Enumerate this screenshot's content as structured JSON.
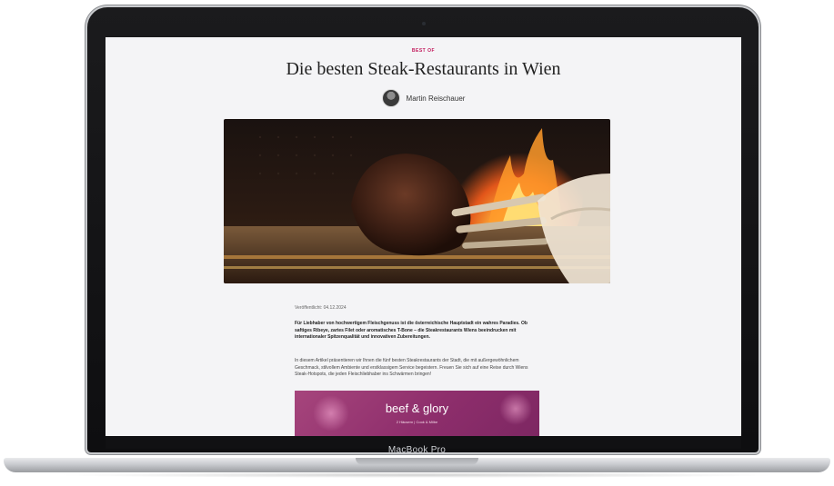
{
  "device": {
    "label": "MacBook Pro"
  },
  "article": {
    "category": "BEST OF",
    "title": "Die besten Steak-Restaurants in Wien",
    "author": "Martin Reischauer",
    "hero_alt": "steak-on-grill-photo",
    "date": "Veröffentlicht: 04.12.2024",
    "lead": "Für Liebhaber von hochwertigem Fleischgenuss ist die österreichische Hauptstadt ein wahres Paradies. Ob saftiges Ribeye, zartes Filet oder aromatisches T-Bone – die Steakrestaurants Wiens beeindrucken mit internationaler Spitzenqualität und innovativen Zubereitungen.",
    "body": "In diesem Artikel präsentieren wir Ihnen die fünf besten Steakrestaurants der Stadt, die mit außergewöhnlichem Geschmack, stilvollem Ambiente und erstklassigem Service begeistern. Freuen Sie sich auf eine Reise durch Wiens Steak-Hotspots, die jeden Fleischliebhaber ins Schwärmen bringen!"
  },
  "promo": {
    "title": "beef & glory",
    "subtitle": "2 Häusern | Cook & Milbe"
  },
  "colors": {
    "accent": "#c2185b",
    "promo": "#962f6e"
  }
}
